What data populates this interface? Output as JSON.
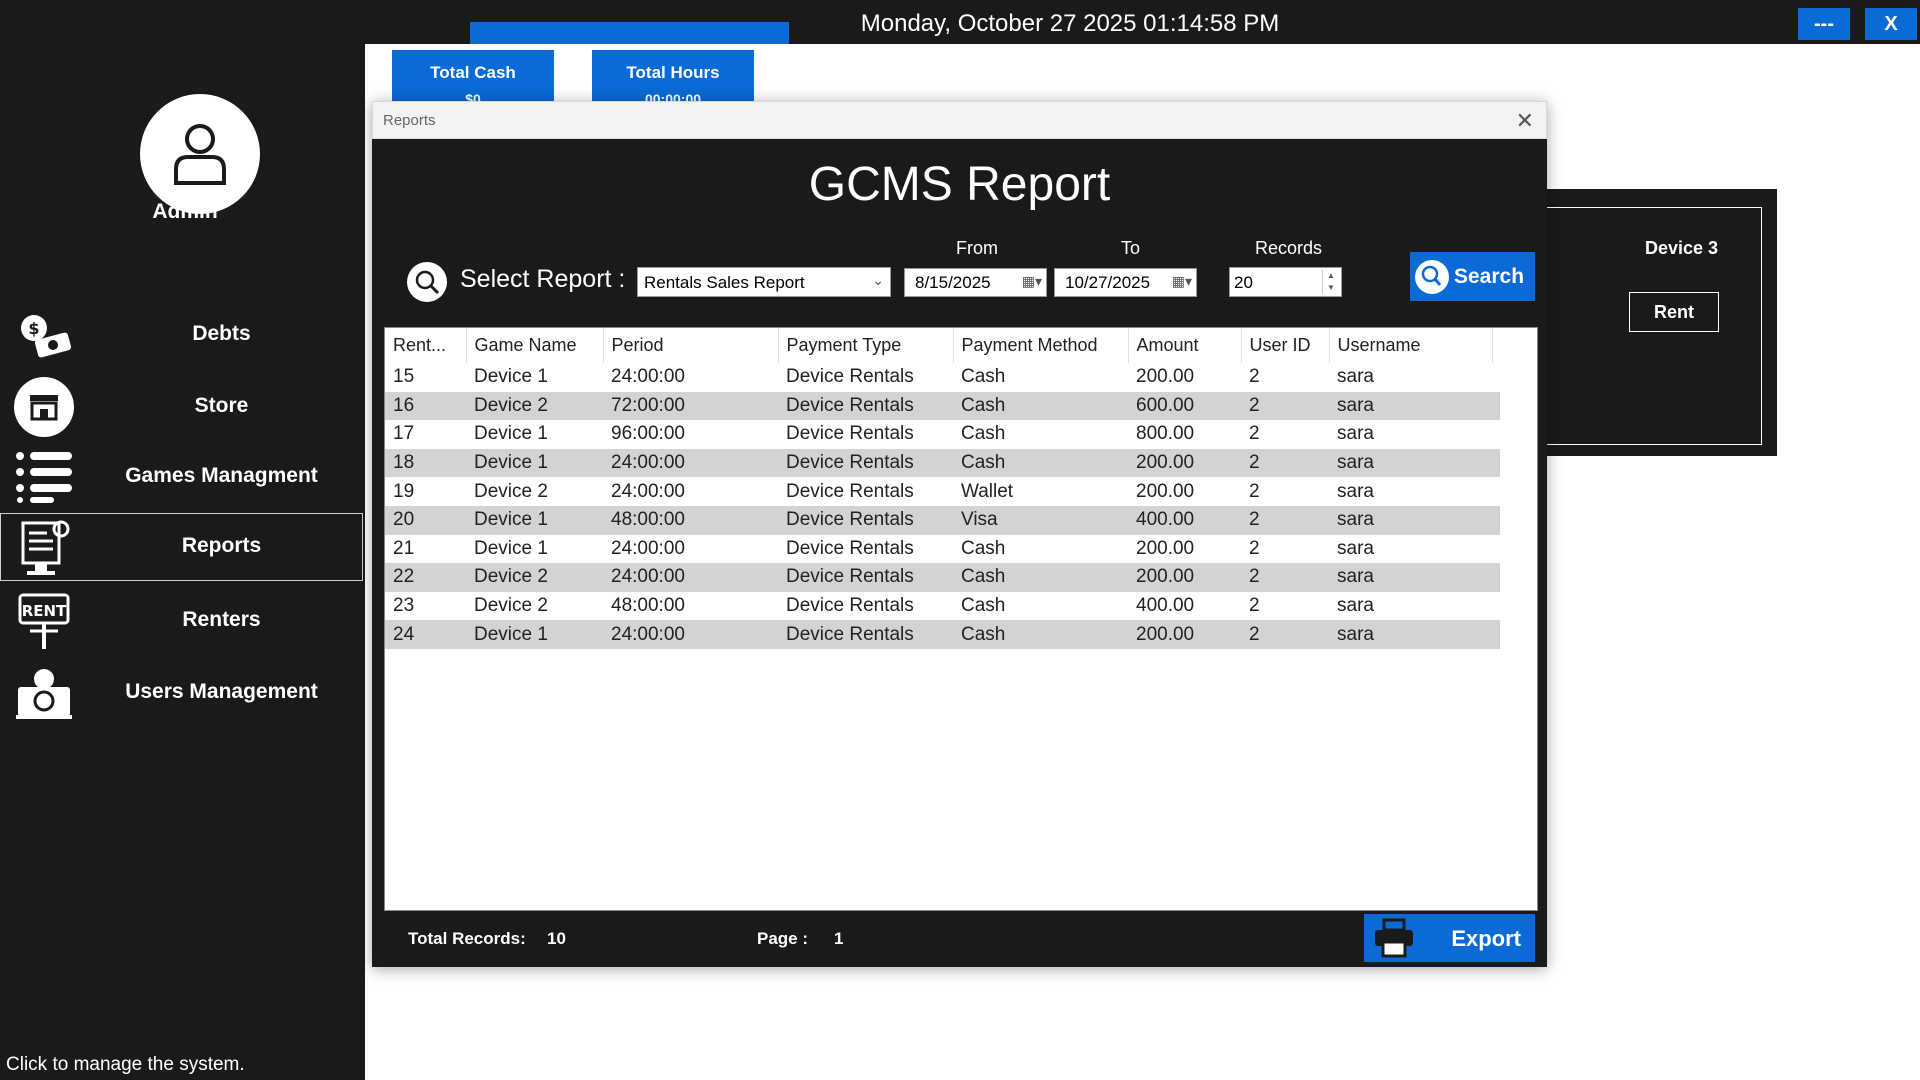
{
  "topbar": {
    "datetime": "Monday, October 27 2025  01:14:58 PM",
    "minimize_label": "---",
    "close_label": "X"
  },
  "sidebar": {
    "user_name": "Admin",
    "items": [
      {
        "label": "Debts",
        "icon": "money-bag-icon"
      },
      {
        "label": "Store",
        "icon": "store-icon"
      },
      {
        "label": "Games Managment",
        "icon": "list-icon"
      },
      {
        "label": "Reports",
        "icon": "report-icon",
        "selected": true
      },
      {
        "label": "Renters",
        "icon": "rent-sign-icon"
      },
      {
        "label": "Users Management",
        "icon": "user-admin-icon"
      }
    ],
    "status": "Click to manage the system."
  },
  "main": {
    "total_cash_label": "Total Cash",
    "total_cash_value": "$0",
    "total_hours_label": "Total Hours",
    "total_hours_value": "00:00:00",
    "device_card": {
      "name": "Device 3",
      "rent_label": "Rent"
    }
  },
  "dialog": {
    "window_title": "Reports",
    "report_title": "GCMS Report",
    "select_label": "Select Report :",
    "report_type": "Rentals Sales Report",
    "from_label": "From",
    "from_date": "8/15/2025",
    "to_label": "To",
    "to_date": "10/27/2025",
    "records_label": "Records",
    "records_value": "20",
    "search_label": "Search",
    "export_label": "Export",
    "total_records_label": "Total Records:",
    "total_records_value": "10",
    "page_label": "Page :",
    "page_value": "1"
  },
  "table": {
    "columns": [
      "Rent...",
      "Game Name",
      "Period",
      "Payment Type",
      "Payment Method",
      "Amount",
      "User ID",
      "Username"
    ],
    "rows": [
      [
        "15",
        "Device 1",
        "24:00:00",
        "Device Rentals",
        "Cash",
        "200.00",
        "2",
        "sara"
      ],
      [
        "16",
        "Device 2",
        "72:00:00",
        "Device Rentals",
        "Cash",
        "600.00",
        "2",
        "sara"
      ],
      [
        "17",
        "Device 1",
        "96:00:00",
        "Device Rentals",
        "Cash",
        "800.00",
        "2",
        "sara"
      ],
      [
        "18",
        "Device 1",
        "24:00:00",
        "Device Rentals",
        "Cash",
        "200.00",
        "2",
        "sara"
      ],
      [
        "19",
        "Device 2",
        "24:00:00",
        "Device Rentals",
        "Wallet",
        "200.00",
        "2",
        "sara"
      ],
      [
        "20",
        "Device 1",
        "48:00:00",
        "Device Rentals",
        "Visa",
        "400.00",
        "2",
        "sara"
      ],
      [
        "21",
        "Device 1",
        "24:00:00",
        "Device Rentals",
        "Cash",
        "200.00",
        "2",
        "sara"
      ],
      [
        "22",
        "Device 2",
        "24:00:00",
        "Device Rentals",
        "Cash",
        "200.00",
        "2",
        "sara"
      ],
      [
        "23",
        "Device 2",
        "48:00:00",
        "Device Rentals",
        "Cash",
        "400.00",
        "2",
        "sara"
      ],
      [
        "24",
        "Device 1",
        "24:00:00",
        "Device Rentals",
        "Cash",
        "200.00",
        "2",
        "sara"
      ]
    ]
  },
  "colors": {
    "accent": "#0a6ad6",
    "dark": "#1a1a1a",
    "row_alt": "#d3d3d3"
  }
}
